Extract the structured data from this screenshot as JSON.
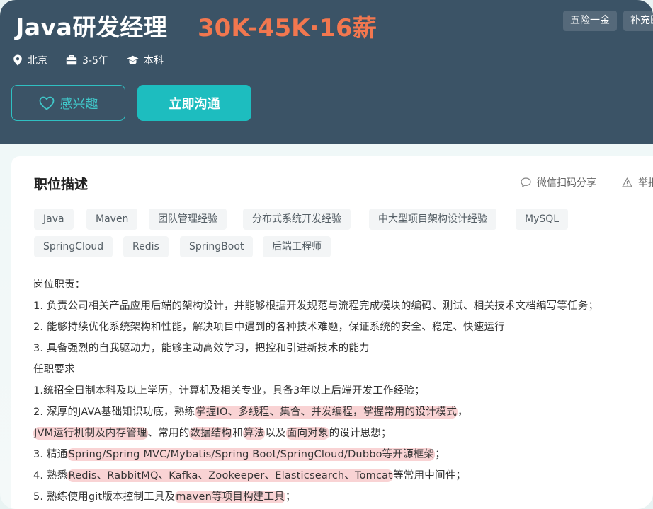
{
  "header": {
    "title": "Java研发经理",
    "salary": "30K-45K·16薪",
    "benefits": [
      "五险一金",
      "补充医"
    ],
    "meta": {
      "location": "北京",
      "experience": "3-5年",
      "education": "本科"
    },
    "interest_label": "感兴趣",
    "chat_label": "立即沟通"
  },
  "card": {
    "title": "职位描述",
    "share_label": "微信扫码分享",
    "report_label": "举报",
    "tags": [
      "Java",
      "Maven",
      "团队管理经验",
      "分布式系统开发经验",
      "中大型项目架构设计经验",
      "MySQL",
      "SpringCloud",
      "Redis",
      "SpringBoot",
      "后端工程师"
    ],
    "description": {
      "l1": "岗位职责：",
      "l2": "1. 负责公司相关产品应用后端的架构设计，并能够根据开发规范与流程完成模块的编码、测试、相关技术文档编写等任务；",
      "l3": "2. 能够持续优化系统架构和性能，解决项目中遇到的各种技术难题，保证系统的安全、稳定、快速运行",
      "l4": "3. 具备强烈的自我驱动力，能够主动高效学习，把控和引进新技术的能力",
      "l5": "任职要求",
      "l6": "1.统招全日制本科及以上学历，计算机及相关专业，具备3年以上后端开发工作经验；",
      "l7a": "2. 深厚的JAVA基础知识功底，熟练",
      "l7b": "掌握IO、多线程、集合、并发编程，掌握常用的设计模式",
      "l7c": "，",
      "l8a": "JVM运行机制及内存管理",
      "l8b": "、常用的",
      "l8c": "数据结构",
      "l8d": "和",
      "l8e": "算法",
      "l8f": "以及",
      "l8g": "面向对象",
      "l8h": "的设计思想；",
      "l9a": "3. 精通",
      "l9b": "Spring/Spring MVC/Mybatis/Spring Boot/SpringCloud/Dubbo等开源框架",
      "l9c": "；",
      "l10a": "4. 熟悉",
      "l10b": "Redis、RabbitMQ、Kafka、Zookeeper、Elasticsearch、Tomcat",
      "l10c": "等常用中间件；",
      "l11a": "5. 熟练使用git版本控制工具及",
      "l11b": "maven等项目构建工具",
      "l11c": "；"
    }
  },
  "colors": {
    "header_bg": "#3b5366",
    "salary": "#f2774f",
    "accent": "#1dbdbf",
    "highlight": "#f9d3d4"
  }
}
